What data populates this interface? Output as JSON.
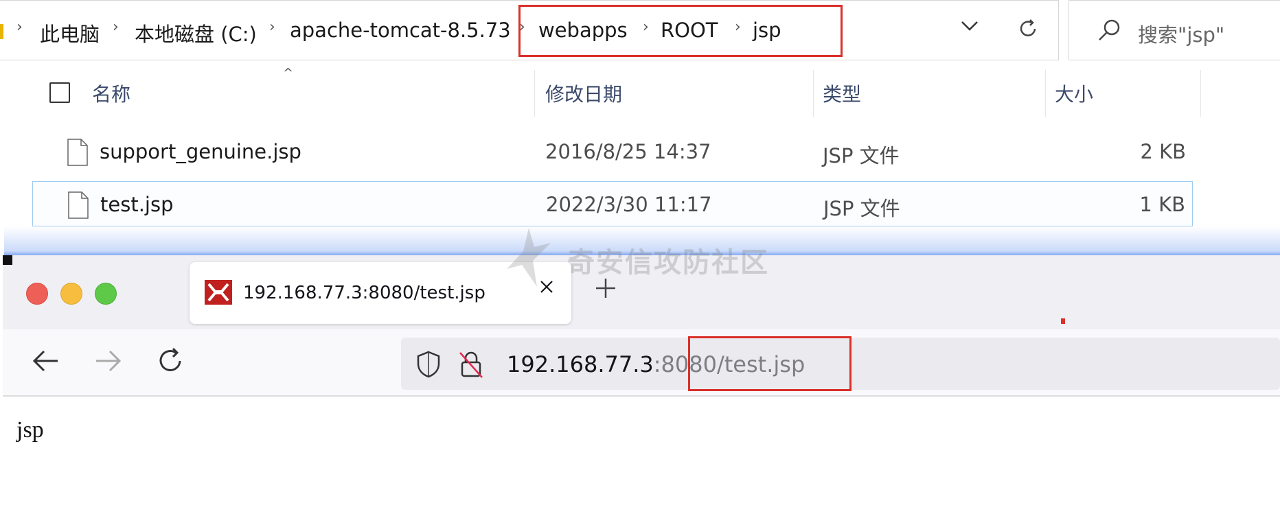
{
  "explorer": {
    "breadcrumbs": [
      "此电脑",
      "本地磁盘 (C:)",
      "apache-tomcat-8.5.73",
      "webapps",
      "ROOT",
      "jsp"
    ],
    "search_placeholder": "搜索\"jsp\"",
    "columns": {
      "name": "名称",
      "modified": "修改日期",
      "type": "类型",
      "size": "大小"
    },
    "files": [
      {
        "name": "support_genuine.jsp",
        "modified": "2016/8/25 14:37",
        "type": "JSP 文件",
        "size": "2 KB"
      },
      {
        "name": "test.jsp",
        "modified": "2022/3/30 11:17",
        "type": "JSP 文件",
        "size": "1 KB"
      }
    ]
  },
  "browser": {
    "tab_title": "192.168.77.3:8080/test.jsp",
    "url_host": "192.168.77.3",
    "url_rest": ":8080/test.jsp",
    "page_text": "jsp"
  },
  "watermark": "奇安信攻防社区",
  "colors": {
    "highlight": "#d9302a",
    "selection_border": "#9ecbf0",
    "traffic_close": "#ee5f57",
    "traffic_min": "#f6bd3e",
    "traffic_max": "#5ec848"
  },
  "icons": {
    "explorer": [
      "chevron-right-icon",
      "chevron-down-icon",
      "refresh-icon",
      "search-icon",
      "sort-up-icon",
      "file-icon"
    ],
    "browser": [
      "close-icon",
      "plus-icon",
      "back-arrow-icon",
      "forward-arrow-icon",
      "reload-icon",
      "shield-icon",
      "insecure-lock-icon",
      "favicon"
    ]
  }
}
